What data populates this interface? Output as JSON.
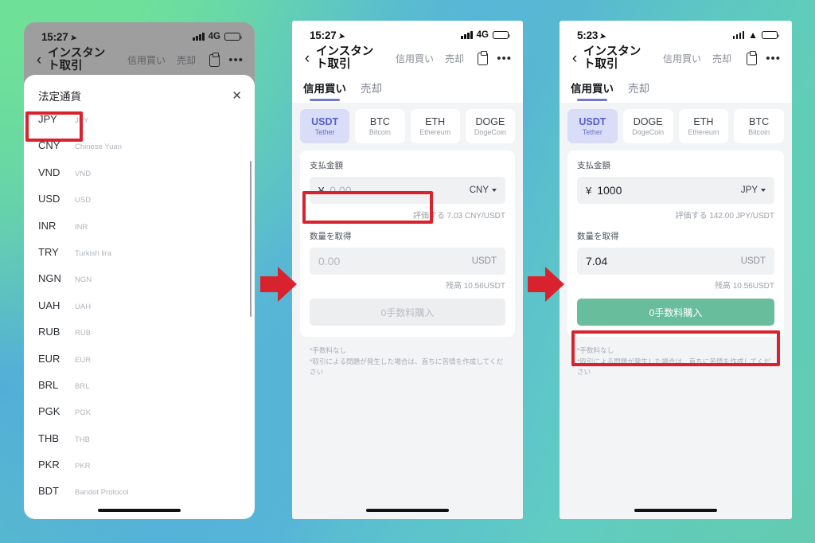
{
  "background": {
    "from": "#6fe0a0",
    "mid": "#55b0dd",
    "to": "#64cbb2"
  },
  "accent": {
    "red": "#d8232f",
    "green_cta": "#68bd9d",
    "chip": "#d9ddf7",
    "chip_text": "#5560c8",
    "tab_indicator": "#6f76d8"
  },
  "arrows": {
    "count": 2,
    "color": "#d8232f",
    "direction": "right"
  },
  "phones": [
    {
      "id": "phone1",
      "status": {
        "time": "15:27",
        "location_icon": "location-arrow",
        "network": "4G",
        "battery": "low",
        "charging": false,
        "wifi": false
      },
      "nav": {
        "back_icon": "chevron-left",
        "title": "インスタント取引",
        "links": [
          "信用買い",
          "売却"
        ],
        "clipboard_icon": "clipboard",
        "more_icon": "ellipsis"
      },
      "dimmed": true,
      "sheet": {
        "title": "法定通貨",
        "close_label": "✕",
        "currencies": [
          {
            "code": "JPY",
            "name": "JPY",
            "highlighted": true
          },
          {
            "code": "CNY",
            "name": "Chinese Yuan",
            "highlighted": false
          },
          {
            "code": "VND",
            "name": "VND",
            "highlighted": false
          },
          {
            "code": "USD",
            "name": "USD",
            "highlighted": false
          },
          {
            "code": "INR",
            "name": "INR",
            "highlighted": false
          },
          {
            "code": "TRY",
            "name": "Turkish lira",
            "highlighted": false
          },
          {
            "code": "NGN",
            "name": "NGN",
            "highlighted": false
          },
          {
            "code": "UAH",
            "name": "UAH",
            "highlighted": false
          },
          {
            "code": "RUB",
            "name": "RUB",
            "highlighted": false
          },
          {
            "code": "EUR",
            "name": "EUR",
            "highlighted": false
          },
          {
            "code": "BRL",
            "name": "BRL",
            "highlighted": false
          },
          {
            "code": "PGK",
            "name": "PGK",
            "highlighted": false
          },
          {
            "code": "THB",
            "name": "THB",
            "highlighted": false
          },
          {
            "code": "PKR",
            "name": "PKR",
            "highlighted": false
          },
          {
            "code": "BDT",
            "name": "Bandot Protocol",
            "highlighted": false
          }
        ]
      }
    },
    {
      "id": "phone2",
      "status": {
        "time": "15:27",
        "location_icon": "location-arrow",
        "network": "4G",
        "battery": "low",
        "charging": false,
        "wifi": false
      },
      "nav": {
        "back_icon": "chevron-left",
        "title": "インスタント取引",
        "links": [
          "信用買い",
          "売却"
        ],
        "clipboard_icon": "clipboard",
        "more_icon": "ellipsis"
      },
      "tabs": [
        {
          "label": "信用買い",
          "active": true
        },
        {
          "label": "売却",
          "active": false
        }
      ],
      "coins": [
        {
          "sym": "USDT",
          "name": "Tether",
          "selected": true
        },
        {
          "sym": "BTC",
          "name": "Bitcoin",
          "selected": false
        },
        {
          "sym": "ETH",
          "name": "Ethereum",
          "selected": false
        },
        {
          "sym": "DOGE",
          "name": "DogeCoin",
          "selected": false
        }
      ],
      "pay": {
        "label": "支払金額",
        "currency_symbol": "¥",
        "value": "",
        "placeholder": "0.00",
        "unit": "CNY",
        "filled": false,
        "highlighted": true
      },
      "rate_hint": "評価する 7.03 CNY/USDT",
      "receive": {
        "label": "数量を取得",
        "value": "",
        "placeholder": "0.00",
        "unit": "USDT",
        "filled": false
      },
      "balance_hint": "残高 10.56USDT",
      "cta": {
        "label": "0手数料購入",
        "enabled": false,
        "highlighted": false
      },
      "disclaimer": [
        "*手数料なし",
        "*取引による問題が発生した場合は、直ちに苦情を作成してください"
      ]
    },
    {
      "id": "phone3",
      "status": {
        "time": "5:23",
        "location_icon": "location-arrow",
        "network": "",
        "battery": "charging",
        "charging": true,
        "wifi": true
      },
      "nav": {
        "back_icon": "chevron-left",
        "title": "インスタント取引",
        "links": [
          "信用買い",
          "売却"
        ],
        "clipboard_icon": "clipboard",
        "more_icon": "ellipsis"
      },
      "tabs": [
        {
          "label": "信用買い",
          "active": true
        },
        {
          "label": "売却",
          "active": false
        }
      ],
      "coins": [
        {
          "sym": "USDT",
          "name": "Tether",
          "selected": true
        },
        {
          "sym": "DOGE",
          "name": "DogeCoin",
          "selected": false
        },
        {
          "sym": "ETH",
          "name": "Ethereum",
          "selected": false
        },
        {
          "sym": "BTC",
          "name": "Bitcoin",
          "selected": false
        }
      ],
      "pay": {
        "label": "支払金額",
        "currency_symbol": "¥",
        "value": "1000",
        "placeholder": "0.00",
        "unit": "JPY",
        "filled": true,
        "highlighted": false
      },
      "rate_hint": "評価する 142.00 JPY/USDT",
      "receive": {
        "label": "数量を取得",
        "value": "7.04",
        "placeholder": "0.00",
        "unit": "USDT",
        "filled": true
      },
      "balance_hint": "残高 10.56USDT",
      "cta": {
        "label": "0手数料購入",
        "enabled": true,
        "highlighted": true
      },
      "disclaimer": [
        "*手数料なし",
        "*取引による問題が発生した場合は、直ちに苦情を作成してください"
      ]
    }
  ]
}
